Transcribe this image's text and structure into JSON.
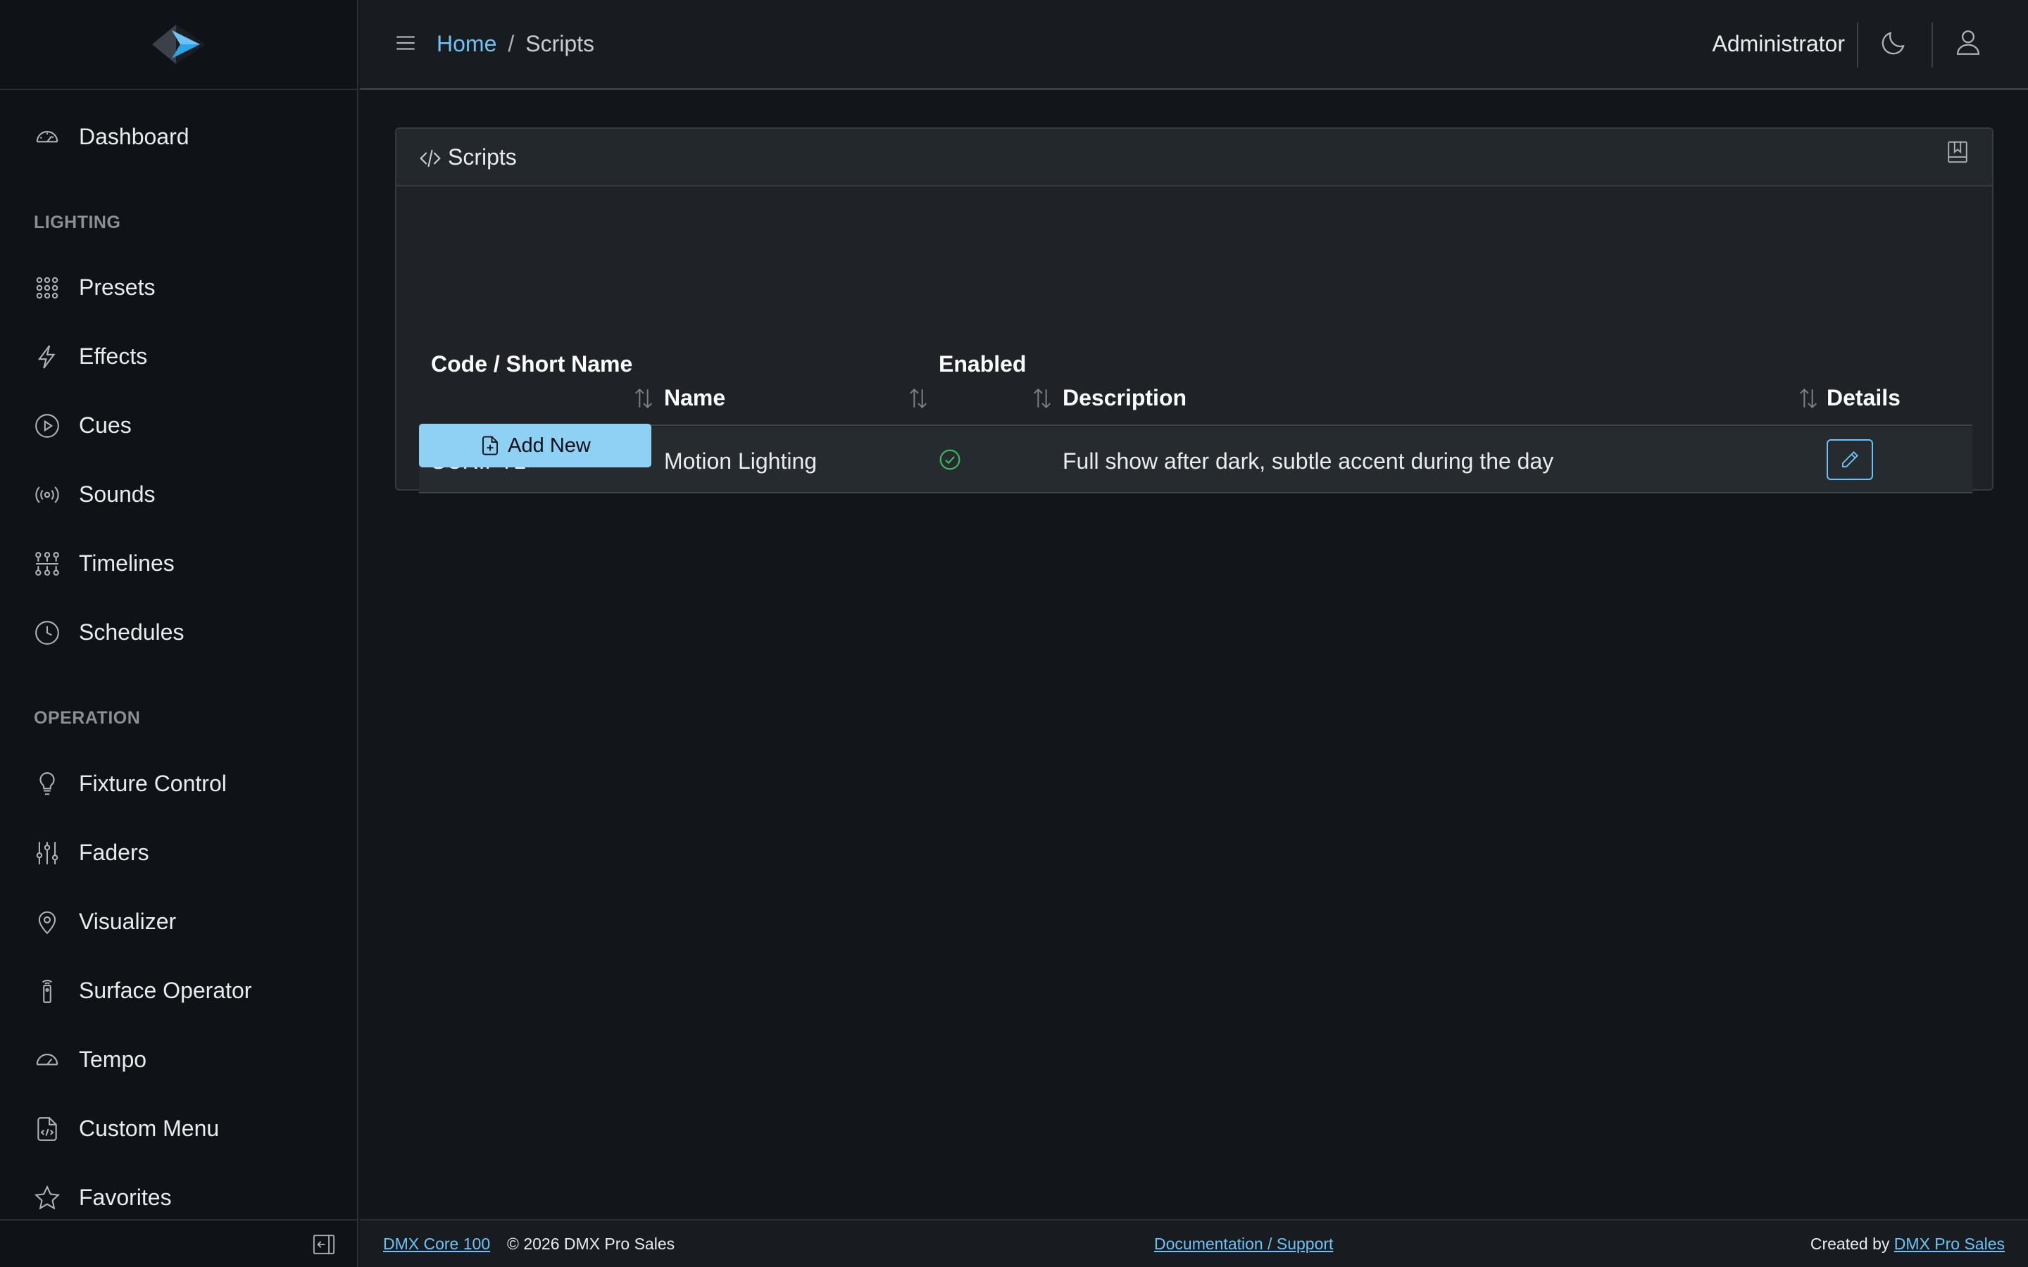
{
  "sidebar": {
    "logo": "dmx-logo",
    "dashboard": "Dashboard",
    "sections": [
      {
        "heading": "LIGHTING",
        "items": [
          {
            "label": "Presets",
            "icon": "grid-dots-icon"
          },
          {
            "label": "Effects",
            "icon": "lightning-icon"
          },
          {
            "label": "Cues",
            "icon": "play-circle-icon"
          },
          {
            "label": "Sounds",
            "icon": "broadcast-icon"
          },
          {
            "label": "Timelines",
            "icon": "timeline-icon"
          },
          {
            "label": "Schedules",
            "icon": "clock-icon"
          }
        ]
      },
      {
        "heading": "OPERATION",
        "items": [
          {
            "label": "Fixture Control",
            "icon": "lightbulb-icon"
          },
          {
            "label": "Faders",
            "icon": "sliders-icon"
          },
          {
            "label": "Visualizer",
            "icon": "map-pin-icon"
          },
          {
            "label": "Surface Operator",
            "icon": "remote-icon"
          },
          {
            "label": "Tempo",
            "icon": "speedometer-icon"
          },
          {
            "label": "Custom Menu",
            "icon": "code-file-icon"
          },
          {
            "label": "Favorites",
            "icon": "star-icon"
          }
        ]
      }
    ]
  },
  "header": {
    "breadcrumb_home": "Home",
    "breadcrumb_sep": "/",
    "breadcrumb_current": "Scripts",
    "user": "Administrator"
  },
  "card": {
    "title": "Scripts",
    "columns": [
      "Code / Short Name",
      "Name",
      "Enabled",
      "Description",
      "Details"
    ],
    "rows": [
      {
        "code": "SCRIPT1",
        "name": "Motion Lighting",
        "enabled": true,
        "description": "Full show after dark, subtle accent during the day"
      }
    ],
    "add_label": "Add New"
  },
  "footer": {
    "product": "DMX Core 100",
    "copyright": "© 2026 DMX Pro Sales",
    "docs": "Documentation / Support",
    "created_by": "Created by",
    "company": "DMX Pro Sales"
  },
  "colors": {
    "accent": "#6ec3f4",
    "button": "#8fd0f5",
    "success": "#3fb95f",
    "background": "#12161a"
  }
}
